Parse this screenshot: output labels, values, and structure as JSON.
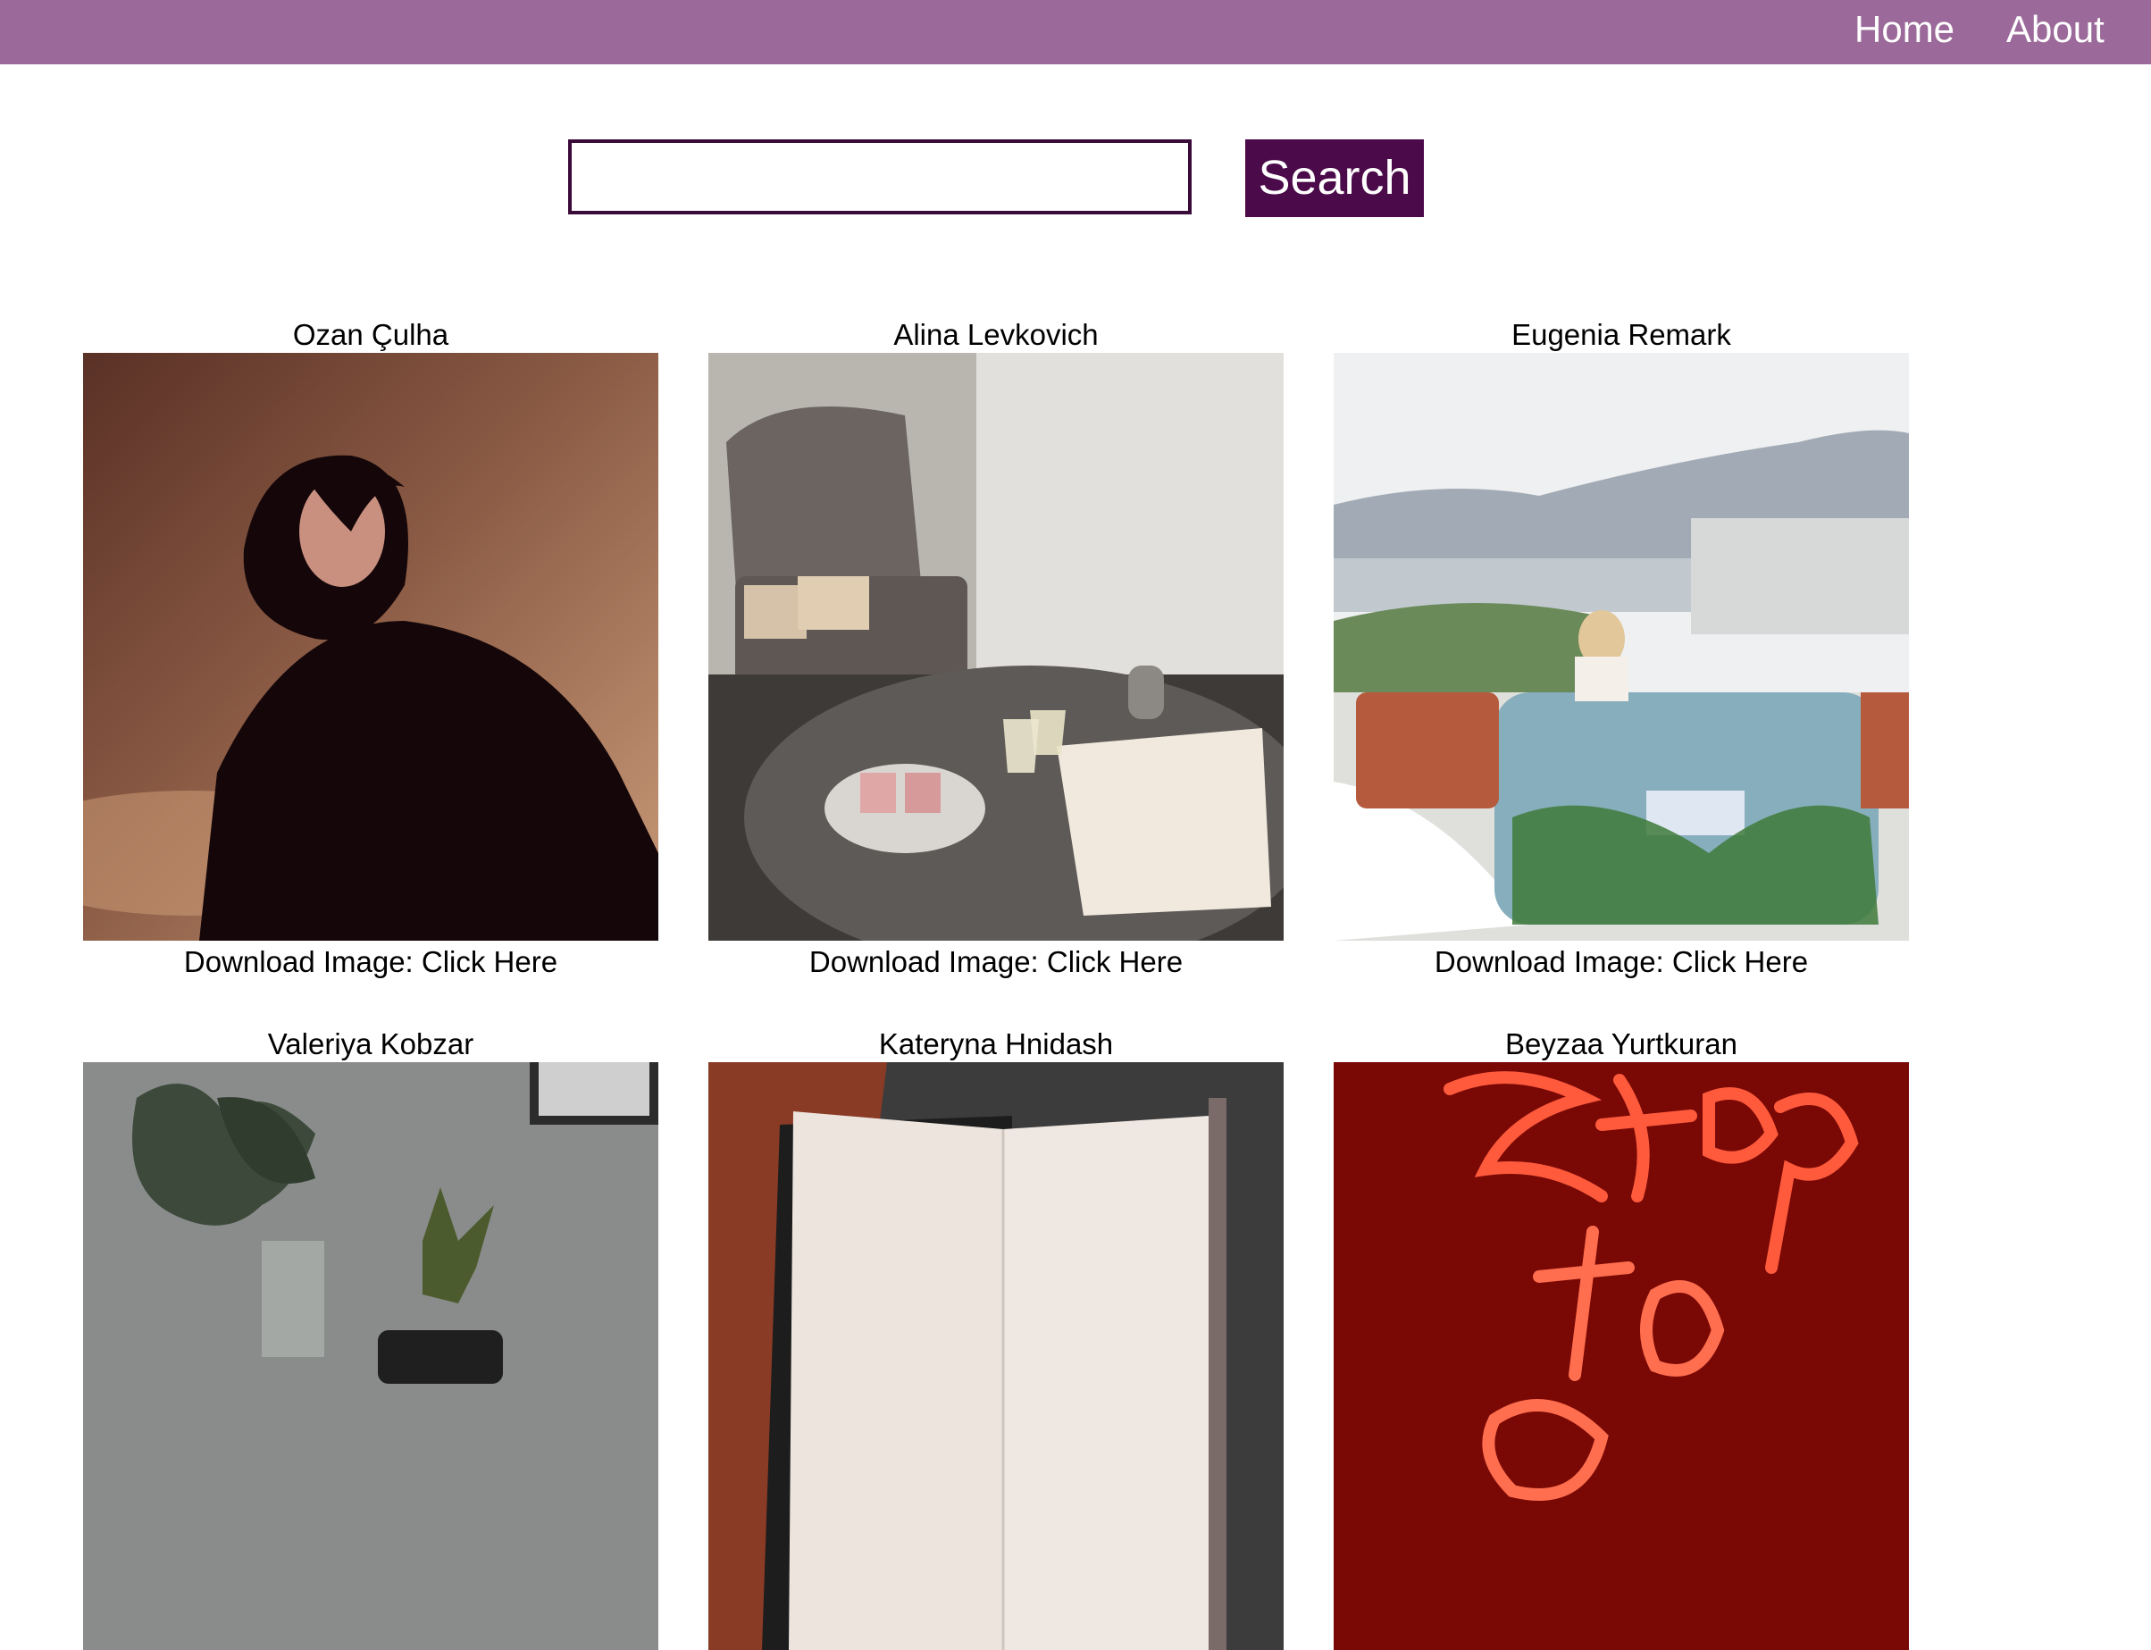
{
  "nav": {
    "items": [
      {
        "label": "Home"
      },
      {
        "label": "About"
      }
    ],
    "background": "#9c6a9a"
  },
  "search": {
    "value": "",
    "placeholder": "",
    "button_label": "Search",
    "button_color": "#4b0a49"
  },
  "gallery": {
    "download_prefix": "Download Image: ",
    "download_link_text": "Click Here",
    "cards": [
      {
        "author": "Ozan Çulha",
        "image": "portrait-photo"
      },
      {
        "author": "Alina Levkovich",
        "image": "table-with-wine-and-book-photo"
      },
      {
        "author": "Eugenia Remark",
        "image": "wedding-convertible-car-photo"
      },
      {
        "author": "Valeriya Kobzar",
        "image": "plants-and-pineapple-photo"
      },
      {
        "author": "Kateryna Hnidash",
        "image": "open-notebook-photo"
      },
      {
        "author": "Beyzaa Yurtkuran",
        "image": "red-neon-sign-photo"
      }
    ]
  }
}
